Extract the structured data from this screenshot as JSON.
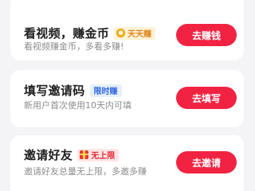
{
  "tasks": [
    {
      "title": "看视频，赚金币",
      "badge": "天天赚",
      "subtitle": "看视频赚金币，多看多赚!",
      "button": "去赚钱"
    },
    {
      "title": "填写邀请码",
      "badge": "限时赚",
      "subtitle": "新用户首次使用10天内可填",
      "button": "去填写"
    },
    {
      "title": "邀请好友",
      "badge": "无上限",
      "subtitle": "邀请好友总量无上限，多邀多赚",
      "button": "去邀请"
    }
  ],
  "icons": {
    "badge_1": "coin-icon",
    "badge_3": "gift-icon"
  },
  "colors": {
    "accent_red": "#f22342",
    "badge_gold": "#e0851b",
    "badge_blue": "#2e6ae0",
    "badge_red": "#e8283a",
    "background": "#f4f4f6"
  }
}
